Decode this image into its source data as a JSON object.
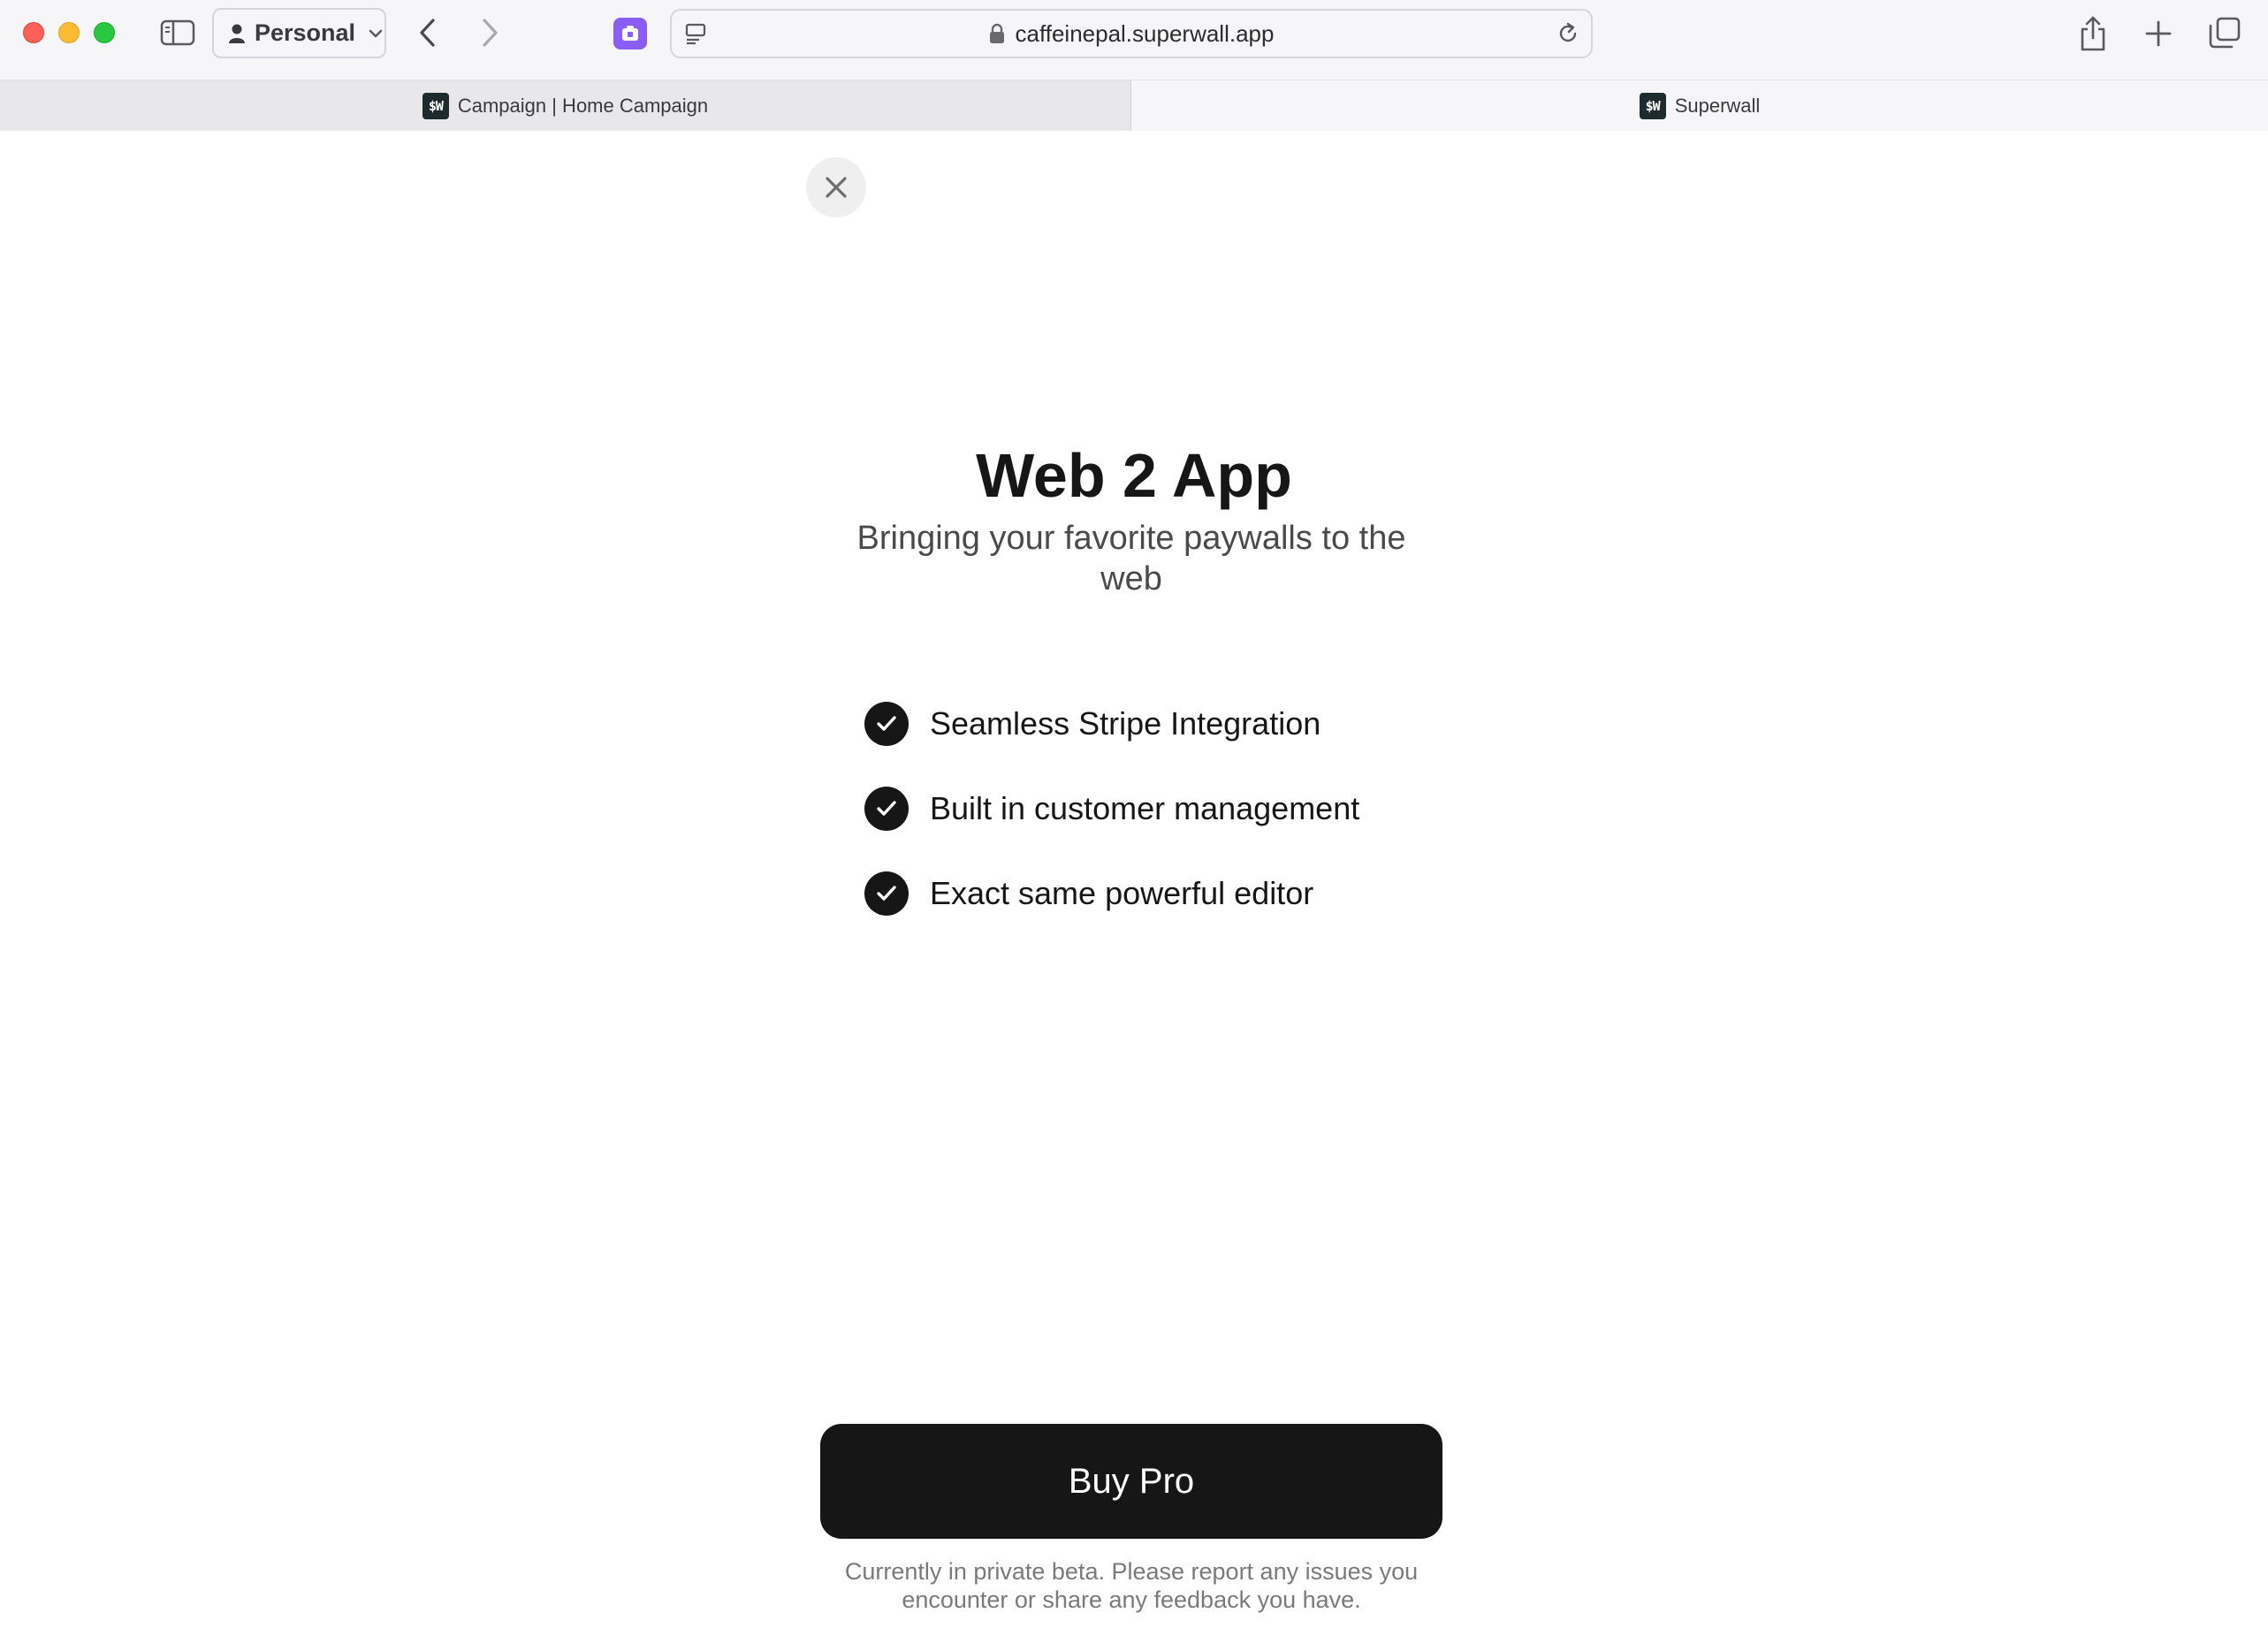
{
  "browser": {
    "profile_label": "Personal",
    "url": "caffeinepal.superwall.app",
    "tabs": [
      {
        "title": "Campaign | Home Campaign",
        "favicon_text": "$W",
        "active": false
      },
      {
        "title": "Superwall",
        "favicon_text": "$W",
        "active": true
      }
    ],
    "icons": [
      "sidebar-icon",
      "person-icon",
      "chevron-down-icon",
      "back-icon",
      "forward-icon",
      "extension-icon",
      "page-menu-icon",
      "lock-icon",
      "reload-icon",
      "share-icon",
      "new-tab-icon",
      "tab-overview-icon"
    ],
    "accent_extension": "#8b5cf6"
  },
  "paywall": {
    "title": "Web 2 App",
    "subtitle": "Bringing your favorite paywalls to the web",
    "features": [
      {
        "label": "Seamless Stripe Integration"
      },
      {
        "label": "Built in customer management"
      },
      {
        "label": "Exact same powerful editor"
      }
    ],
    "cta_label": "Buy Pro",
    "footnote": "Currently in private beta. Please report any issues you encounter or share any feedback you have.",
    "cta_color": "#161616"
  }
}
